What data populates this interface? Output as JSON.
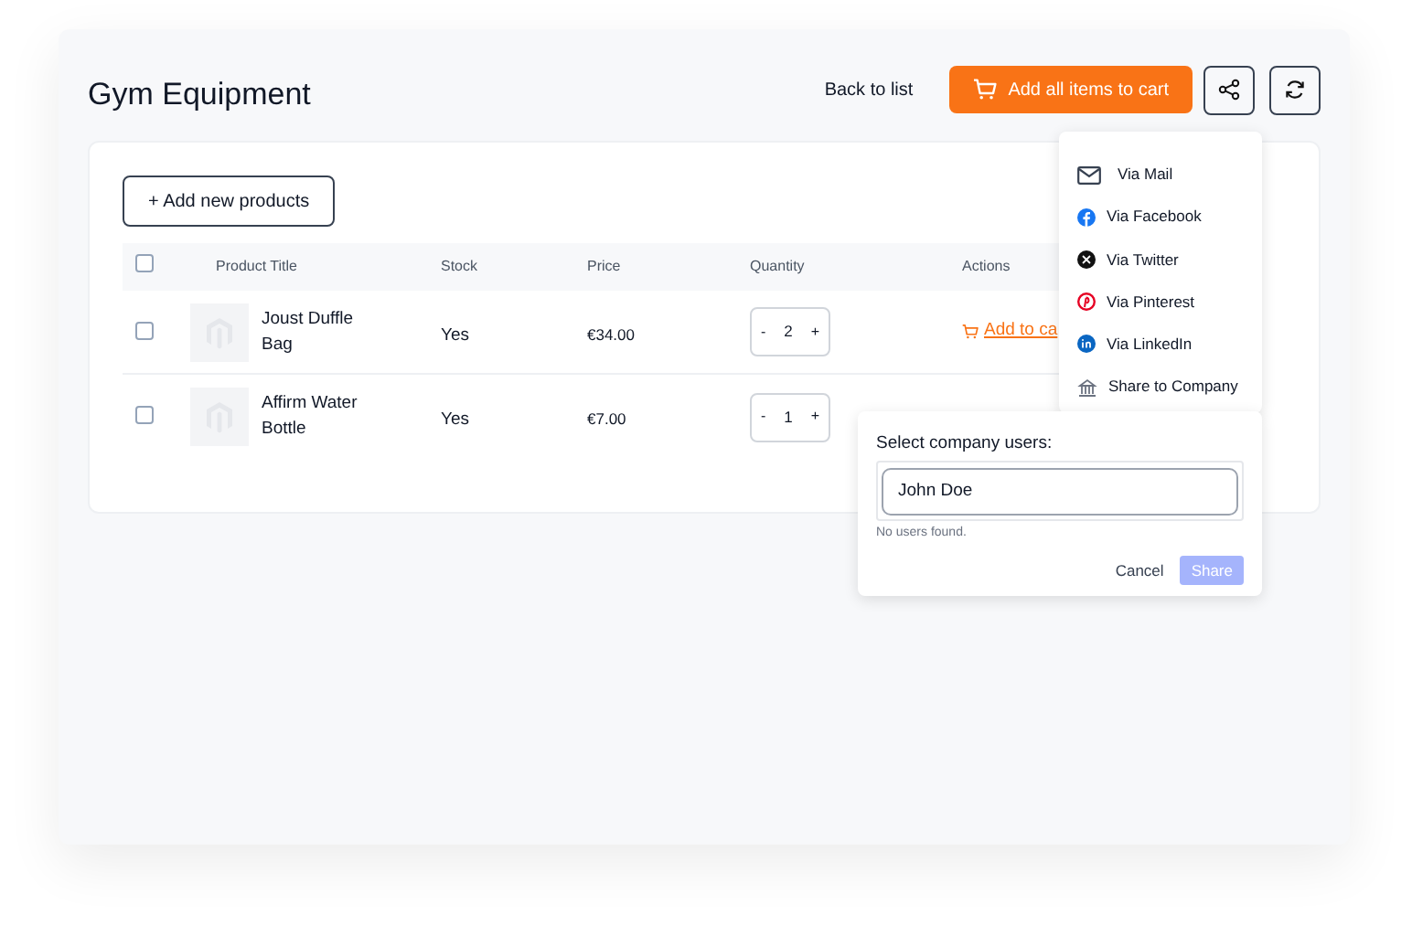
{
  "page": {
    "title": "Gym Equipment",
    "back_link": "Back to list",
    "add_all_button": "Add all items to cart"
  },
  "panel": {
    "add_button": "+ Add new products",
    "table": {
      "columns": [
        "Product Title",
        "Stock",
        "Price",
        "Quantity",
        "Actions"
      ],
      "all_checked": false,
      "rows": [
        {
          "checked": false,
          "title": "Joust Duffle Bag",
          "stock": "Yes",
          "price": "€34.00",
          "minus": "-",
          "quantity": "2",
          "plus": "+",
          "action": "Add to ca"
        },
        {
          "checked": false,
          "title": "Affirm Water Bottle",
          "stock": "Yes",
          "price": "€7.00",
          "minus": "-",
          "quantity": "1",
          "plus": "+"
        }
      ]
    }
  },
  "share_menu": {
    "items": [
      {
        "kind": "mail",
        "label": "Via Mail"
      },
      {
        "kind": "facebook",
        "label": "Via Facebook"
      },
      {
        "kind": "twitter",
        "label": "Via Twitter"
      },
      {
        "kind": "pinterest",
        "label": "Via Pinterest"
      },
      {
        "kind": "linkedin",
        "label": "Via LinkedIn"
      },
      {
        "kind": "company",
        "label": "Share to Company"
      }
    ]
  },
  "company_popover": {
    "label": "Select company users:",
    "value": "John Doe",
    "message": "No users found.",
    "cancel": "Cancel",
    "share": "Share",
    "share_disabled": true
  }
}
